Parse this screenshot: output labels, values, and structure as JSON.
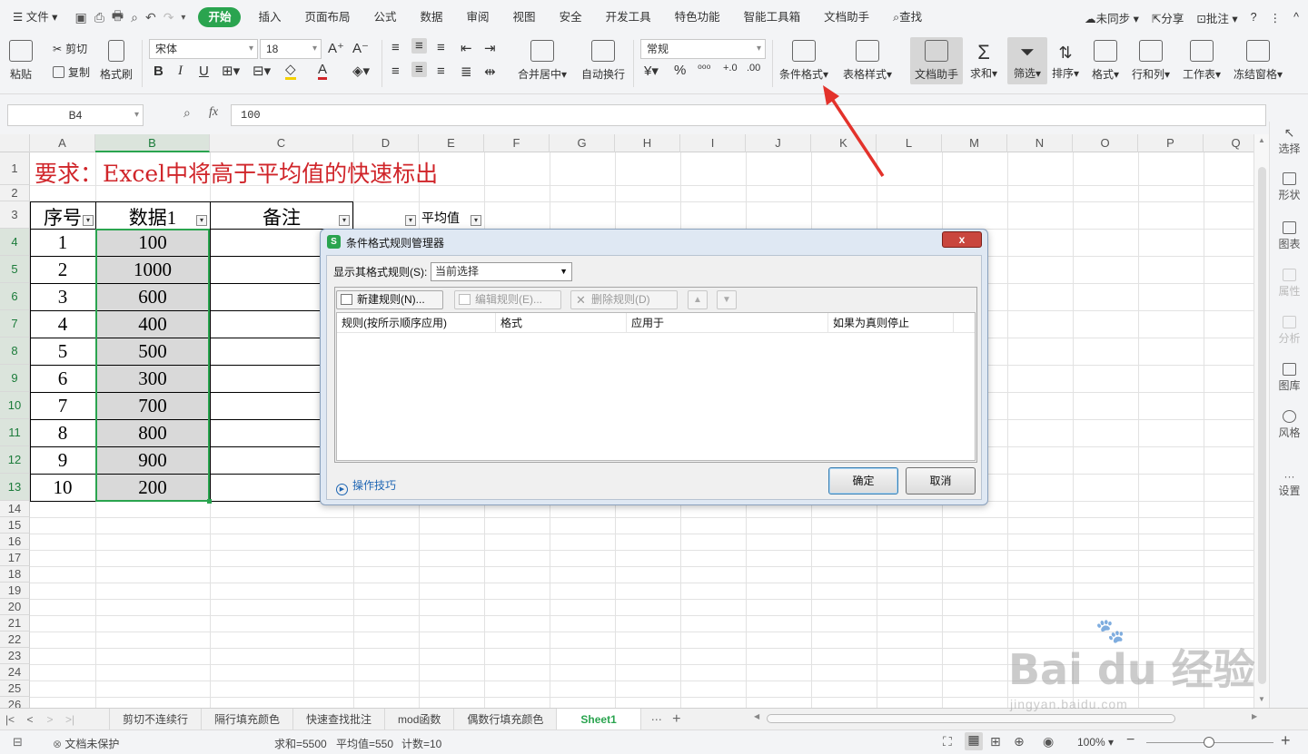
{
  "menubar": {
    "file_label": "文件",
    "tabs": [
      "开始",
      "插入",
      "页面布局",
      "公式",
      "数据",
      "审阅",
      "视图",
      "安全",
      "开发工具",
      "特色功能",
      "智能工具箱",
      "文档助手"
    ],
    "active_tab": "开始",
    "search_label": "查找",
    "sync_label": "未同步",
    "share_label": "分享",
    "comment_label": "批注",
    "help_label": "?",
    "more_label": "⋮",
    "collapse_label": "^"
  },
  "ribbon": {
    "paste": "粘贴",
    "cut": "剪切",
    "copy": "复制",
    "format_painter": "格式刷",
    "font_name": "宋体",
    "font_size": "18",
    "bold": "B",
    "italic": "I",
    "underline": "U",
    "merge_center": "合并居中",
    "wrap_text": "自动换行",
    "number_format": "常规",
    "percent": "%",
    "conditional_format": "条件格式",
    "table_style": "表格样式",
    "doc_assistant": "文档助手",
    "sum": "求和",
    "filter": "筛选",
    "sort": "排序",
    "format": "格式",
    "row_col": "行和列",
    "worksheet": "工作表",
    "freeze": "冻结窗格"
  },
  "formula_bar": {
    "cell_ref": "B4",
    "fx": "fx",
    "value": "100"
  },
  "sidebar": {
    "items": [
      "选择",
      "形状",
      "图表",
      "属性",
      "分析",
      "图库",
      "风格",
      "设置"
    ]
  },
  "grid": {
    "columns": [
      "A",
      "B",
      "C",
      "D",
      "E",
      "F",
      "G",
      "H",
      "I",
      "J",
      "K",
      "L",
      "M",
      "N",
      "O",
      "P",
      "Q"
    ],
    "rows": [
      "1",
      "2",
      "3",
      "4",
      "5",
      "6",
      "7",
      "8",
      "9",
      "10",
      "11",
      "12",
      "13",
      "14",
      "15",
      "16",
      "17",
      "18",
      "19",
      "20",
      "21",
      "22",
      "23",
      "24",
      "25",
      "26"
    ],
    "title": "要求：Excel中将高于平均值的快速标出",
    "headers": {
      "seq": "序号",
      "data1": "数据1",
      "note": "备注",
      "average": "平均值"
    },
    "seq_values": [
      "1",
      "2",
      "3",
      "4",
      "5",
      "6",
      "7",
      "8",
      "9",
      "10"
    ],
    "data_values": [
      "100",
      "1000",
      "600",
      "400",
      "500",
      "300",
      "700",
      "800",
      "900",
      "200"
    ]
  },
  "sheet_tabs": {
    "tabs": [
      "剪切不连续行",
      "隔行填充颜色",
      "快速查找批注",
      "mod函数",
      "偶数行填充颜色",
      "Sheet1"
    ],
    "active": "Sheet1",
    "more": "⋯",
    "add": "+"
  },
  "status": {
    "protect": "文档未保护",
    "sum": "求和=5500",
    "average": "平均值=550",
    "count": "计数=10",
    "zoom": "100%"
  },
  "dialog": {
    "title": "条件格式规则管理器",
    "close": "x",
    "show_rules_label": "显示其格式规则(S):",
    "show_rules_value": "当前选择",
    "new_rule": "新建规则(N)...",
    "edit_rule": "编辑规则(E)...",
    "delete_rule": "删除规则(D)",
    "columns": [
      "规则(按所示顺序应用)",
      "格式",
      "应用于",
      "如果为真则停止"
    ],
    "tips": "操作技巧",
    "ok": "确定",
    "cancel": "取消"
  },
  "watermark": {
    "main": "Bai du 经验",
    "sub": "jingyan.baidu.com"
  },
  "colors": {
    "accent": "#2aa44f",
    "title_red": "#d0252a",
    "selection_fill": "#d9d9d9",
    "arrow_red": "#e3322b"
  }
}
